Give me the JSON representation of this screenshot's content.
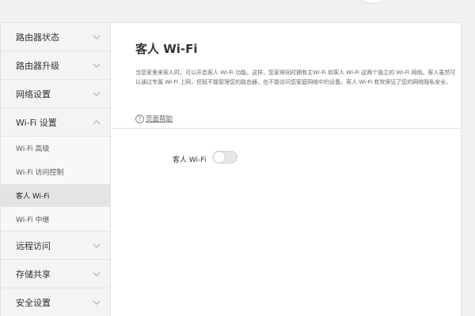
{
  "sidebar": {
    "items": [
      {
        "label": "路由器状态"
      },
      {
        "label": "路由器升级"
      },
      {
        "label": "网络设置"
      },
      {
        "label": "Wi-Fi 设置"
      }
    ],
    "wifi_submenu": [
      {
        "label": "Wi-Fi 高级"
      },
      {
        "label": "Wi-Fi 访问控制"
      },
      {
        "label": "客人 Wi-Fi"
      },
      {
        "label": "Wi-Fi 中继"
      }
    ],
    "items_after": [
      {
        "label": "远程访问"
      },
      {
        "label": "存储共享"
      },
      {
        "label": "安全设置"
      }
    ]
  },
  "main": {
    "title": "客人 Wi-Fi",
    "description": "当您家里来客人时，可以开启客人 Wi-Fi 功能。这样，您家将同时拥有主Wi-Fi 和客人 Wi-Fi 这两个独立的 Wi-Fi 网络。客人虽然可以通过专属 Wi-Fi 上网，但既不能管理您的路由器，也不能访问您家庭网络中的设备。客人 Wi-Fi 有效保证了您的网络隐私安全。",
    "help_link": "页面帮助",
    "toggle_label": "客人 Wi-Fi",
    "toggle_on": false
  },
  "colors": {
    "accent": "#2fb7a9",
    "active_row": "#e4e4e4"
  }
}
